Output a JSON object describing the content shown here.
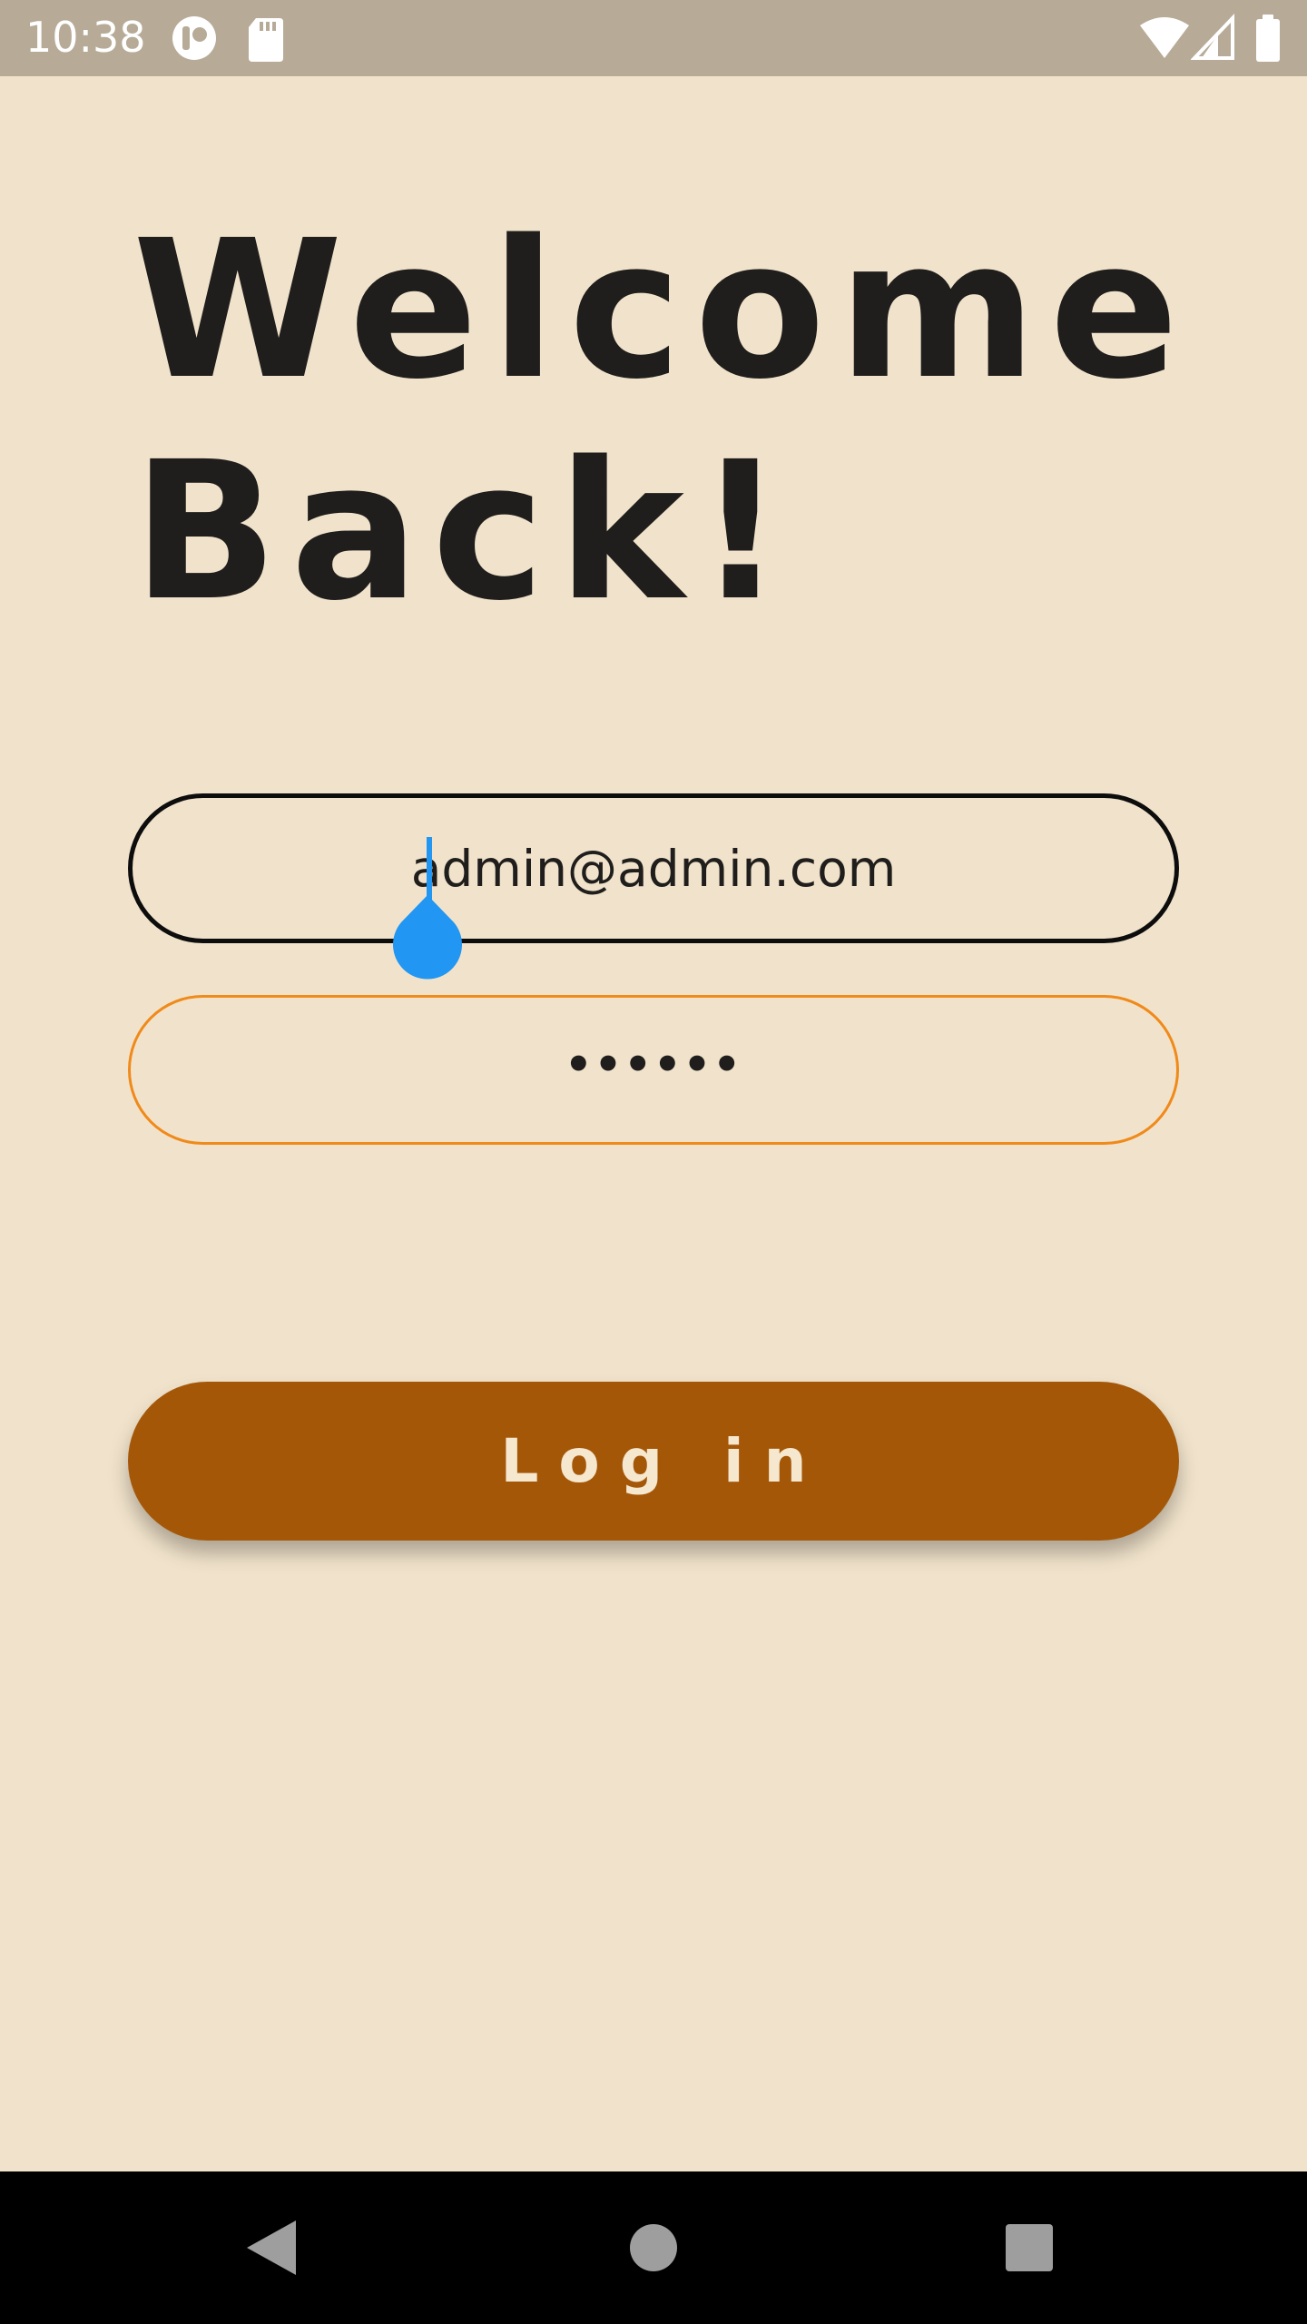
{
  "status_bar": {
    "time": "10:38",
    "icons": [
      "app-notification-icon",
      "sd-card-icon",
      "wifi-icon",
      "cell-signal-icon",
      "battery-icon"
    ],
    "background": "#b7ab98"
  },
  "login": {
    "title_line1": "Welcome",
    "title_line2": "Back!",
    "email_value": "admin@admin.com",
    "password_value": "••••••",
    "login_label": "Log in"
  },
  "colors": {
    "background": "#f1e3cb",
    "title": "#1f1e1c",
    "email_border": "#0d0d0d",
    "password_border": "#f08a1a",
    "button": "#a55708",
    "button_text": "#f6e7cf",
    "cursor": "#2196f3"
  },
  "nav_bar": {
    "icons": [
      "back-icon",
      "home-icon",
      "recents-icon"
    ]
  }
}
